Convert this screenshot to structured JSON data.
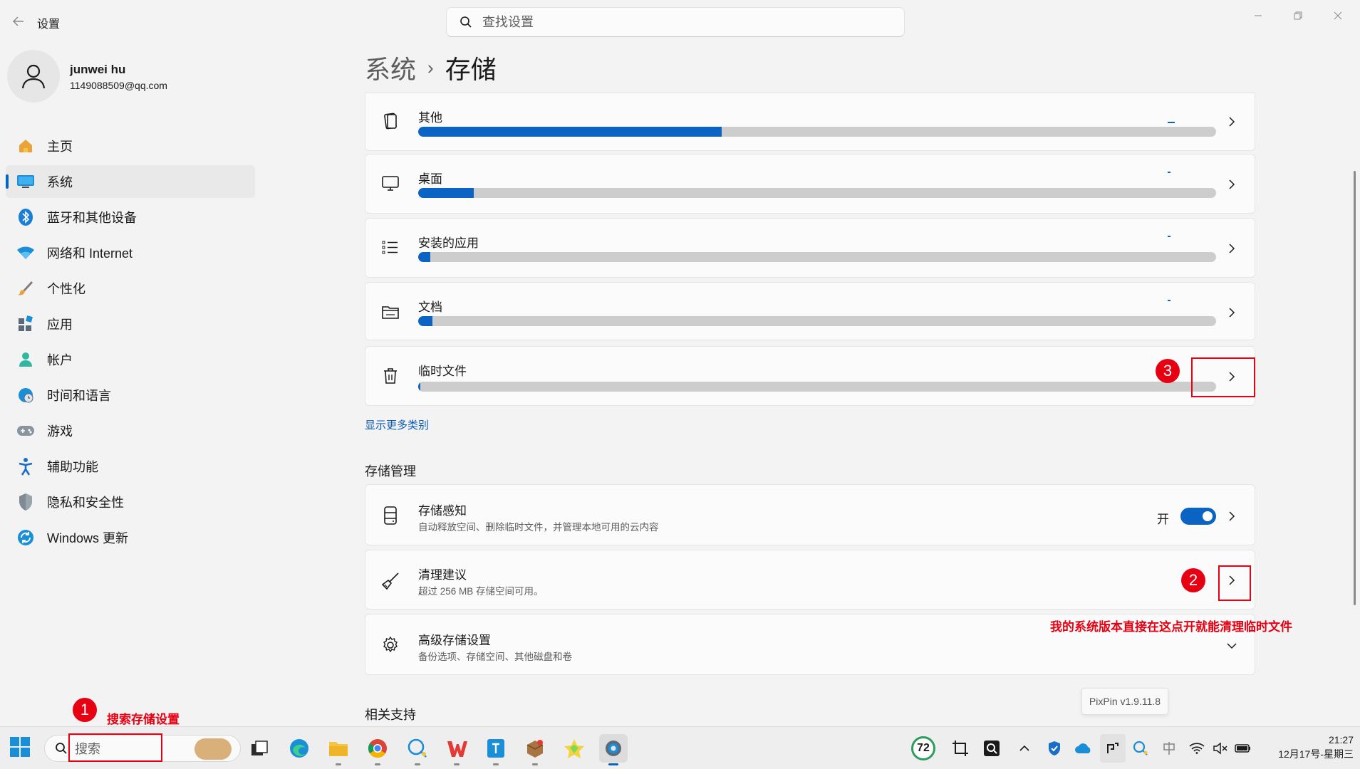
{
  "window": {
    "title": "设置",
    "back_icon": "arrow-left-icon",
    "search_placeholder": "查找设置"
  },
  "user": {
    "name": "junwei hu",
    "email": "1149088509@qq.com"
  },
  "sidebar": {
    "items": [
      {
        "label": "主页",
        "icon": "home-icon"
      },
      {
        "label": "系统",
        "icon": "system-display-icon",
        "active": true
      },
      {
        "label": "蓝牙和其他设备",
        "icon": "bluetooth-icon"
      },
      {
        "label": "网络和 Internet",
        "icon": "wifi-icon"
      },
      {
        "label": "个性化",
        "icon": "brush-icon"
      },
      {
        "label": "应用",
        "icon": "apps-icon"
      },
      {
        "label": "帐户",
        "icon": "account-icon"
      },
      {
        "label": "时间和语言",
        "icon": "globe-clock-icon"
      },
      {
        "label": "游戏",
        "icon": "gamepad-icon"
      },
      {
        "label": "辅助功能",
        "icon": "accessibility-icon"
      },
      {
        "label": "隐私和安全性",
        "icon": "shield-icon"
      },
      {
        "label": "Windows 更新",
        "icon": "update-icon"
      }
    ]
  },
  "breadcrumb": {
    "parent": "系统",
    "separator": "›",
    "current": "存储"
  },
  "storage_categories": [
    {
      "label": "其他",
      "icon": "other-files-icon",
      "fill": 0.38
    },
    {
      "label": "桌面",
      "icon": "desktop-icon",
      "fill": 0.07
    },
    {
      "label": "安装的应用",
      "icon": "list-icon",
      "fill": 0.015
    },
    {
      "label": "文档",
      "icon": "folder-icon",
      "fill": 0.018
    },
    {
      "label": "临时文件",
      "icon": "trash-icon",
      "fill": 0.003
    }
  ],
  "show_more_link": "显示更多类别",
  "storage_management": {
    "section_title": "存储管理",
    "storage_sense": {
      "title": "存储感知",
      "subtitle": "自动释放空间、删除临时文件，并管理本地可用的云内容",
      "toggle_label": "开",
      "toggle_on": true
    },
    "cleanup": {
      "title": "清理建议",
      "subtitle": "超过 256 MB 存储空间可用。"
    },
    "advanced": {
      "title": "高级存储设置",
      "subtitle": "备份选项、存储空间、其他磁盘和卷"
    }
  },
  "related_support": "相关支持",
  "annotations": {
    "step1_number": "1",
    "step1_text": "搜索存储设置",
    "step2_number": "2",
    "step2_text": "我的系统版本直接在这点开就能清理临时文件",
    "step3_number": "3",
    "color": "#e60012"
  },
  "tooltip": "PixPin v1.9.11.8",
  "taskbar": {
    "search_placeholder": "搜索",
    "badge_number": "72",
    "time": "21:27",
    "date": "12月17号-星期三"
  },
  "colors": {
    "accent": "#0b63c4",
    "background": "#f3f3f3",
    "card": "#fbfbfb"
  }
}
